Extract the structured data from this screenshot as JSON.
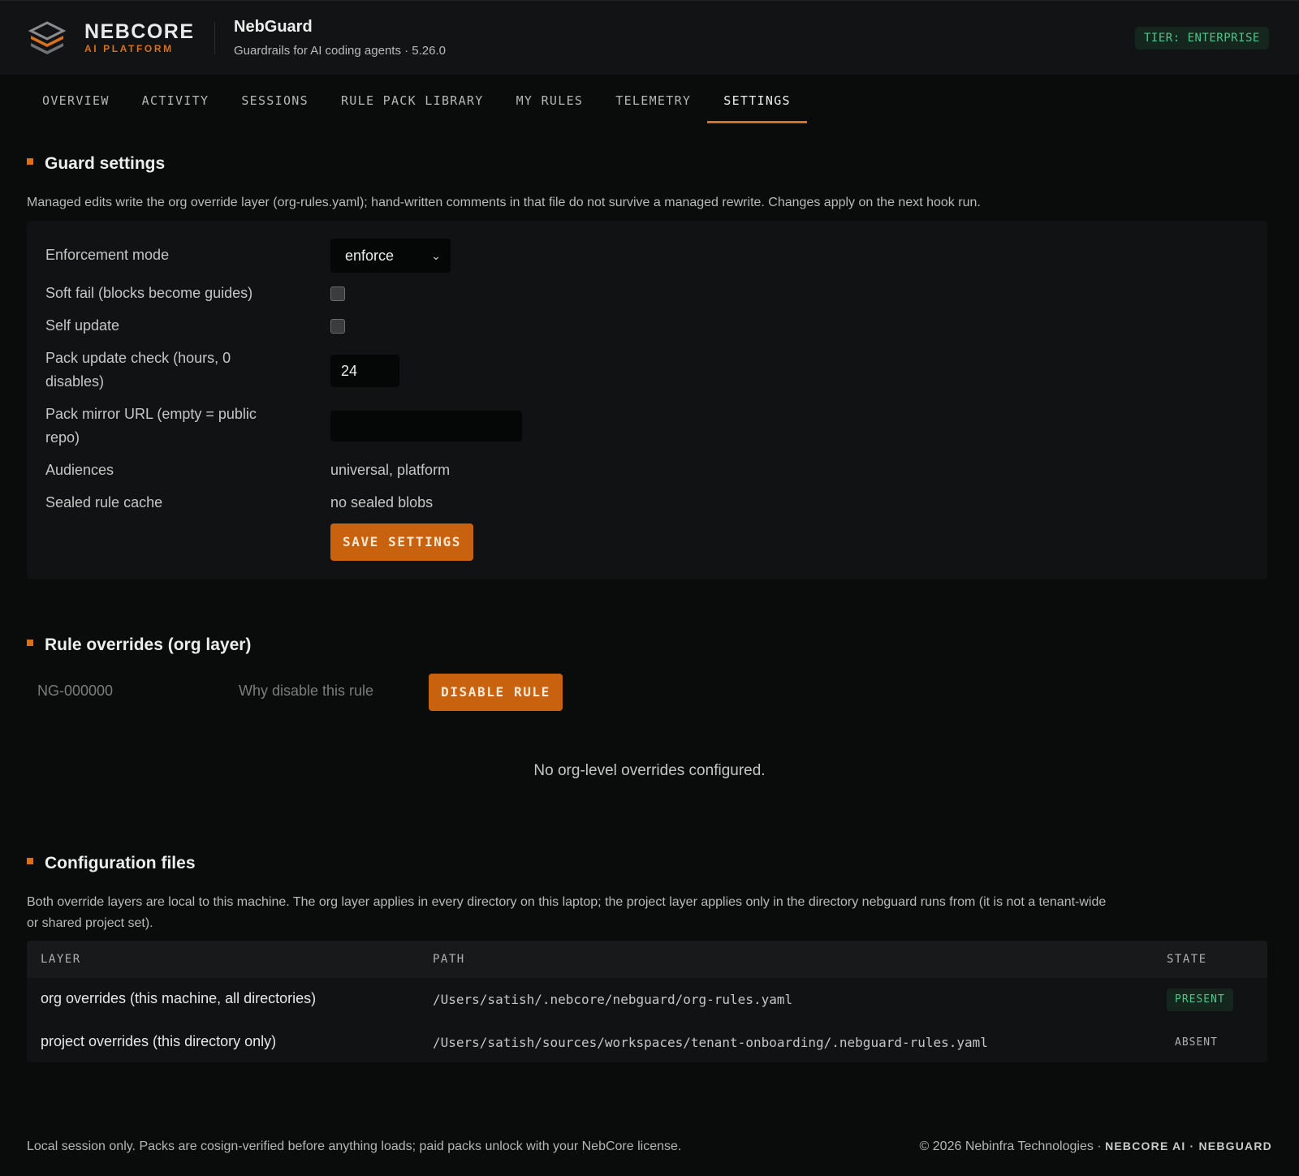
{
  "header": {
    "brand_name": "NEBCORE",
    "brand_sub": "AI PLATFORM",
    "app_title": "NebGuard",
    "app_subtitle": "Guardrails for AI coding agents · 5.26.0",
    "tier": "TIER: ENTERPRISE",
    "logo_icon": "stacked-layers-icon"
  },
  "tabs": [
    {
      "label": "OVERVIEW"
    },
    {
      "label": "ACTIVITY"
    },
    {
      "label": "SESSIONS"
    },
    {
      "label": "RULE PACK LIBRARY"
    },
    {
      "label": "MY RULES"
    },
    {
      "label": "TELEMETRY"
    },
    {
      "label": "SETTINGS",
      "active": true
    }
  ],
  "guard": {
    "title": "Guard settings",
    "description": "Managed edits write the org override layer (org-rules.yaml); hand-written comments in that file do not survive a managed rewrite. Changes apply on the next hook run.",
    "enforcement_label": "Enforcement mode",
    "enforcement_value": "enforce",
    "softfail_label": "Soft fail (blocks become guides)",
    "softfail_checked": false,
    "selfupdate_label": "Self update",
    "selfupdate_checked": false,
    "packcheck_label_1": "Pack update check (hours, 0",
    "packcheck_label_2": "disables)",
    "packcheck_value": "24",
    "mirror_label_1": "Pack mirror URL (empty = public",
    "mirror_label_2": "repo)",
    "mirror_value": "",
    "audiences_label": "Audiences",
    "audiences_value": "universal, platform",
    "sealed_label": "Sealed rule cache",
    "sealed_value": "no sealed blobs",
    "save_label": "SAVE SETTINGS"
  },
  "overrides": {
    "title": "Rule overrides (org layer)",
    "rule_placeholder": "NG-000000",
    "reason_placeholder": "Why disable this rule",
    "disable_label": "DISABLE RULE",
    "empty_message": "No org-level overrides configured."
  },
  "config": {
    "title": "Configuration files",
    "description_1": "Both override layers are local to this machine. The org layer applies in every directory on this laptop; the project layer applies only in the directory nebguard runs from (it is not a tenant-wide",
    "description_2": "or shared project set).",
    "columns": {
      "layer": "LAYER",
      "path": "PATH",
      "state": "STATE"
    },
    "rows": [
      {
        "layer": "org overrides (this machine, all directories)",
        "path": "/Users/satish/.nebcore/nebguard/org-rules.yaml",
        "state": "PRESENT"
      },
      {
        "layer": "project overrides (this directory only)",
        "path": "/Users/satish/sources/workspaces/tenant-onboarding/.nebguard-rules.yaml",
        "state": "ABSENT"
      }
    ]
  },
  "footer": {
    "left": "Local session only. Packs are cosign-verified before anything loads; paid packs unlock with your NebCore license.",
    "right_prefix": "© 2026 Nebinfra Technologies ·",
    "right_brand": "NEBCORE AI · NEBGUARD"
  },
  "colors": {
    "accent": "#d9701b",
    "success": "#4ec68a",
    "background": "#0a0b0b"
  }
}
